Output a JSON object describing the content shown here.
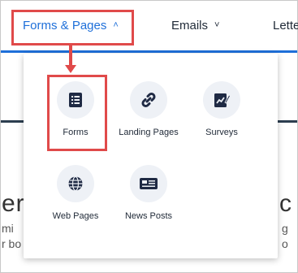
{
  "nav": {
    "items": [
      {
        "label": "Forms & Pages",
        "chevron": "˄"
      },
      {
        "label": "Emails",
        "chevron": "˅"
      },
      {
        "label": "Lette"
      }
    ]
  },
  "background": {
    "heading_fragment": "er'",
    "line1_fragment": "mi",
    "line2_fragment": "r bo",
    "right_heading_fragment": "c",
    "right_line1_fragment": "g",
    "right_line2_fragment": "o"
  },
  "menu": {
    "tiles": [
      {
        "label": "Forms",
        "icon": "list-form-icon"
      },
      {
        "label": "Landing Pages",
        "icon": "link-icon"
      },
      {
        "label": "Surveys",
        "icon": "survey-chart-icon"
      },
      {
        "label": "Web Pages",
        "icon": "globe-icon"
      },
      {
        "label": "News Posts",
        "icon": "newspaper-icon"
      }
    ]
  },
  "colors": {
    "accent": "#1e6fd9",
    "highlight": "#e04a4a",
    "icon_bg": "#eef1f6",
    "icon_fg": "#1f2a44"
  }
}
